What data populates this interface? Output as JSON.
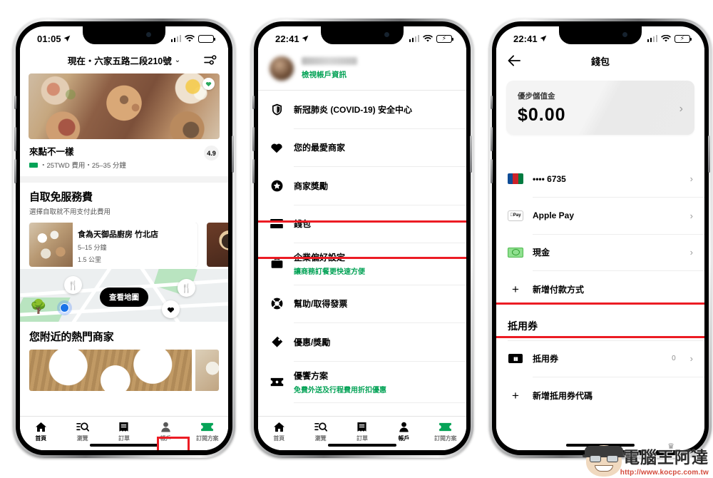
{
  "watermark": {
    "text": "電腦王阿達",
    "url": "http://www.kocpc.com.tw"
  },
  "phone1": {
    "status": {
      "time": "01:05",
      "location_icon": "location-arrow-icon",
      "signal_icon": "cellular-bars-icon",
      "wifi_icon": "wifi-icon",
      "battery_icon": "battery-icon"
    },
    "header": {
      "address": "現在・六家五路二段210號",
      "chevron": "⌄",
      "filter_icon": "filter-sliders-icon"
    },
    "hero_restaurant": {
      "name": "來點不一樣",
      "meta": "・25TWD 費用・25–35 分鐘",
      "rating": "4.9",
      "favorite_icon": "heart-icon"
    },
    "promo": {
      "title": "自取免服務費",
      "subtitle": "選擇自取就不用支付此費用"
    },
    "carousel": [
      {
        "name": "食為天御品廚房 竹北店",
        "time": "5–15 分鐘",
        "distance": "1.5 公里"
      }
    ],
    "map": {
      "view_map_label": "查看地圖",
      "pin_icon": "restaurant-fork-knife-icon",
      "favorite_pin_icon": "heart-icon",
      "tree_icon": "tree-icon",
      "my_location_icon": "blue-dot-icon"
    },
    "near_title": "您附近的熱門商家",
    "tabs": [
      {
        "label": "首頁",
        "icon": "home-icon",
        "active": true
      },
      {
        "label": "瀏覽",
        "icon": "search-list-icon",
        "active": false
      },
      {
        "label": "訂單",
        "icon": "receipt-icon",
        "active": false
      },
      {
        "label": "帳戶",
        "icon": "person-icon",
        "active": false
      },
      {
        "label": "訂閱方案",
        "icon": "ticket-icon",
        "active": false
      }
    ]
  },
  "phone2": {
    "status": {
      "time": "22:41"
    },
    "account": {
      "name_redacted": "",
      "view_info_label": "檢視帳戶資訊",
      "avatar_icon": "avatar-icon"
    },
    "menu": [
      {
        "label": "新冠肺炎 (COVID-19) 安全中心",
        "sub": "",
        "icon": "shield-icon",
        "highlighted": false
      },
      {
        "label": "您的最愛商家",
        "sub": "",
        "icon": "heart-icon",
        "highlighted": false
      },
      {
        "label": "商家獎勵",
        "sub": "",
        "icon": "star-badge-icon",
        "highlighted": false
      },
      {
        "label": "錢包",
        "sub": "",
        "icon": "wallet-card-icon",
        "highlighted": true
      },
      {
        "label": "企業偏好設定",
        "sub": "讓商務訂餐更快速方便",
        "icon": "briefcase-icon",
        "highlighted": false
      },
      {
        "label": "幫助/取得發票",
        "sub": "",
        "icon": "lifebuoy-icon",
        "highlighted": false
      },
      {
        "label": "優惠/獎勵",
        "sub": "",
        "icon": "tag-icon",
        "highlighted": false
      },
      {
        "label": "優饗方案",
        "sub": "免費外送及行程費用折扣優惠",
        "icon": "ticket-icon",
        "highlighted": false
      }
    ],
    "tabs": [
      {
        "label": "首頁",
        "icon": "home-icon",
        "active": false
      },
      {
        "label": "瀏覽",
        "icon": "search-list-icon",
        "active": false
      },
      {
        "label": "訂單",
        "icon": "receipt-icon",
        "active": false
      },
      {
        "label": "帳戶",
        "icon": "person-icon",
        "active": true
      },
      {
        "label": "訂閱方案",
        "icon": "ticket-icon",
        "active": false
      }
    ]
  },
  "phone3": {
    "status": {
      "time": "22:41"
    },
    "header": {
      "title": "錢包",
      "back_icon": "back-arrow-icon"
    },
    "uber_cash": {
      "label": "優步儲值金",
      "amount": "$0.00",
      "chevron": "›"
    },
    "payment_methods": [
      {
        "label": "•••• 6735",
        "icon": "jcb-card-icon",
        "value": "",
        "chevron": "›",
        "highlighted": false
      },
      {
        "label": "Apple Pay",
        "icon": "apple-pay-icon",
        "value": "",
        "chevron": "›",
        "highlighted": false
      },
      {
        "label": "現金",
        "icon": "cash-icon",
        "value": "",
        "chevron": "›",
        "highlighted": false
      }
    ],
    "add_payment": {
      "label": "新增付款方式",
      "icon": "plus-icon",
      "highlighted": true
    },
    "voucher_section": {
      "title": "抵用券",
      "row": {
        "label": "抵用券",
        "icon": "voucher-icon",
        "count": "0",
        "chevron": "›"
      },
      "add": {
        "label": "新增抵用券代碼",
        "icon": "plus-icon"
      }
    }
  }
}
